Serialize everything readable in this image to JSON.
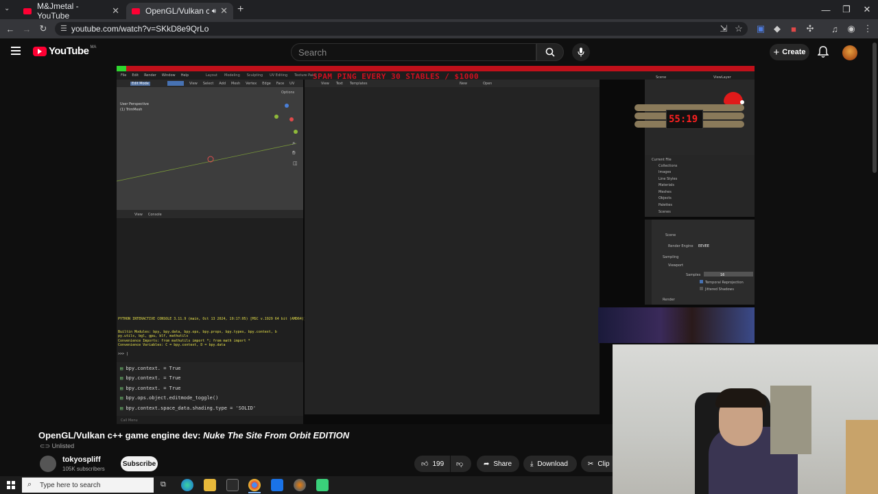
{
  "browser": {
    "tabs": [
      {
        "label": "M&Jmetal - YouTube",
        "close": "✕"
      },
      {
        "label": "OpenGL/Vulkan c++ game",
        "close": "✕"
      }
    ],
    "new_tab": "+",
    "window_controls": [
      "—",
      "❐",
      "✕"
    ],
    "url": "youtube.com/watch?v=SKkD8e9QrLo"
  },
  "youtube": {
    "logo_text": "YouTube",
    "logo_region": "MA",
    "search_placeholder": "Search",
    "create_label": "Create"
  },
  "video": {
    "overlay_text": "SPAM PING EVERY 30 STABLES / $1000",
    "timer": "55:19",
    "blender": {
      "menu": [
        "File",
        "Edit",
        "Render",
        "Window",
        "Help"
      ],
      "workspaces": [
        "Layout",
        "Modeling",
        "Sculpting",
        "UV Editing",
        "Texture Paint"
      ],
      "mode": "Edit Mode",
      "header_items": [
        "View",
        "Select",
        "Add",
        "Mesh",
        "Vertex",
        "Edge",
        "Face",
        "UV"
      ],
      "options": "Options",
      "viewport_label": "User Perspective",
      "viewport_sub": "(1) TrimMesh",
      "text_editor_items": [
        "View",
        "Text",
        "Templates"
      ],
      "new_btn": "New",
      "open_btn": "Open",
      "console_menu": [
        "View",
        "Console"
      ],
      "console_lines": [
        "PYTHON INTERACTIVE CONSOLE 3.11.9 (main, Oct 13 2024, 19:17:05) [MSC v.1929 64 bit (AMD64)]",
        "Builtin Modules:       bpy, bpy.data, bpy.ops, bpy.props, bpy.types, bpy.context, b",
        "py.utils, bgl, gpu, blf, mathutils",
        "Convenience Imports:   from mathutils import *; from math import *",
        "Convenience Variables: C = bpy.context, D = bpy.data"
      ],
      "prompt": ">>> |",
      "history": [
        "bpy.context. = True",
        "bpy.context. = True",
        "bpy.context. = True",
        "bpy.ops.object.editmode_toggle()",
        "bpy.context.space_data.shading.type = 'SOLID'"
      ],
      "status_bar": "Call Menu",
      "scene_label": "Scene",
      "viewlayer_label": "ViewLayer",
      "outliner_root": "Current File",
      "outliner_items": [
        "Collections",
        "Images",
        "Line Styles",
        "Materials",
        "Meshes",
        "Objects",
        "Palettes",
        "Scenes"
      ],
      "props_scene": "Scene",
      "render_engine_label": "Render Engine",
      "render_engine_value": "EEVEE",
      "sampling": "Sampling",
      "viewport": "Viewport",
      "samples_label": "Samples",
      "samples_value": "16",
      "temporal": "Temporal Reprojection",
      "jittered": "Jittered Shadows",
      "render": "Render"
    }
  },
  "meta": {
    "title_plain": "OpenGL/Vulkan c++ game engine dev: ",
    "title_italic": "Nuke The Site From Orbit EDITION",
    "unlisted": "Unlisted",
    "channel_name": "tokyospliff",
    "subscribers": "105K subscribers",
    "subscribe": "Subscribe",
    "likes": "199",
    "share": "Share",
    "download": "Download",
    "clip": "Clip"
  },
  "taskbar": {
    "search_placeholder": "Type here to search"
  },
  "colors": {
    "youtube_red": "#ff0033",
    "console_yellow": "#e6e04a",
    "blender_red_header": "#c0101a"
  }
}
